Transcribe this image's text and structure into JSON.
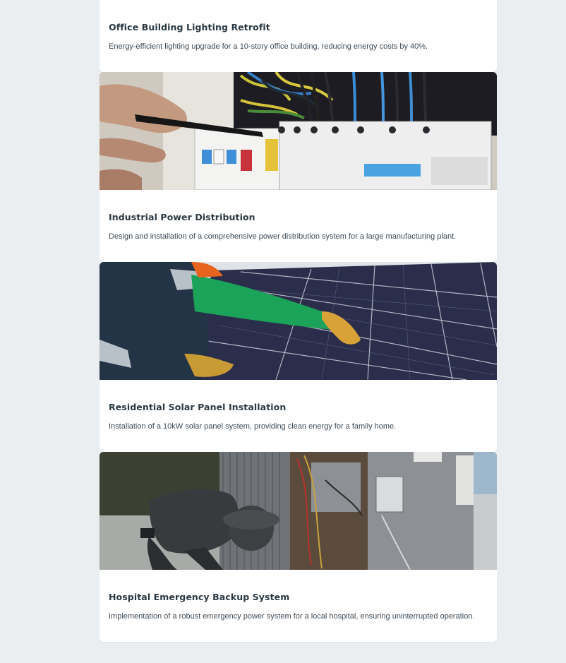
{
  "projects": [
    {
      "title": "Office Building Lighting Retrofit",
      "description": "Energy-efficient lighting upgrade for a 10-story office building, reducing energy costs by 40%."
    },
    {
      "title": "Industrial Power Distribution",
      "description": "Design and installation of a comprehensive power distribution system for a large manufacturing plant."
    },
    {
      "title": "Residential Solar Panel Installation",
      "description": "Installation of a 10kW solar panel system, providing clean energy for a family home."
    },
    {
      "title": "Hospital Emergency Backup System",
      "description": "Implementation of a robust emergency power system for a local hospital, ensuring uninterrupted operation."
    }
  ]
}
